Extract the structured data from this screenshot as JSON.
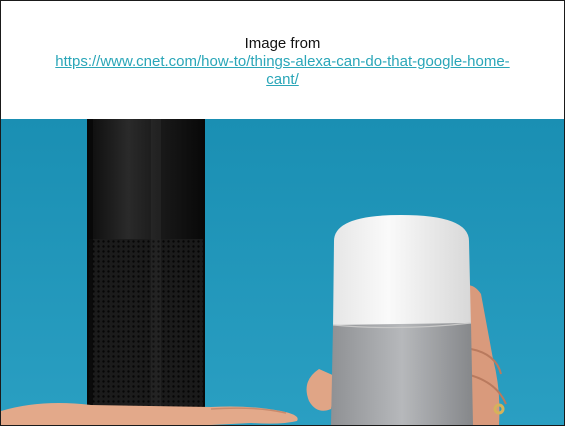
{
  "caption": {
    "prefix": "Image from",
    "link_text": "https://www.cnet.com/how-to/things-alexa-can-do-that-google-home-cant/"
  },
  "photo": {
    "alt": "Amazon Echo and Google Home smart speakers held in hands",
    "colors": {
      "background": "#1f94b8",
      "echo_body": "#141414",
      "google_top": "#f4f4f4",
      "google_base": "#a8aaad",
      "skin": "#e3a98a"
    }
  }
}
